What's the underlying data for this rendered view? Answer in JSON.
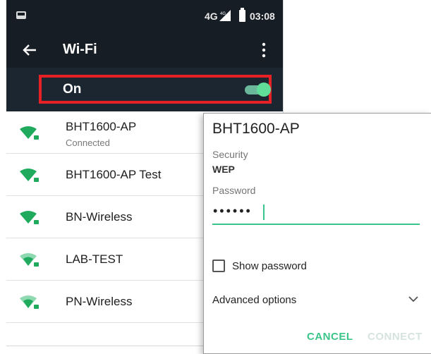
{
  "status_bar": {
    "network": "4G",
    "signal_badge": "4G",
    "time": "03:08",
    "icons": [
      "screenshot-icon",
      "signal-icon",
      "battery-icon"
    ]
  },
  "toolbar": {
    "title": "Wi-Fi",
    "icons": [
      "back-arrow-icon",
      "more-vert-icon"
    ]
  },
  "master_switch": {
    "label": "On",
    "state": "on",
    "highlight_color": "#e62025"
  },
  "networks": [
    {
      "ssid": "BHT1600-AP",
      "status": "Connected",
      "icon": "wifi-lock-icon"
    },
    {
      "ssid": "BHT1600-AP Test",
      "icon": "wifi-lock-icon"
    },
    {
      "ssid": "BN-Wireless",
      "icon": "wifi-lock-icon"
    },
    {
      "ssid": "LAB-TEST",
      "icon": "wifi-lock-icon"
    },
    {
      "ssid": "PN-Wireless",
      "icon": "wifi-lock-icon"
    }
  ],
  "dialog": {
    "title": "BHT1600-AP",
    "security_label": "Security",
    "security_value": "WEP",
    "password_label": "Password",
    "password_value": "••••••",
    "show_password_label": "Show password",
    "show_password_checked": false,
    "advanced_label": "Advanced options",
    "cancel_label": "CANCEL",
    "connect_label": "CONNECT"
  },
  "colors": {
    "accent": "#3bc58a",
    "header_bg": "#161d24",
    "wifi_icon": "#1faa5d"
  }
}
